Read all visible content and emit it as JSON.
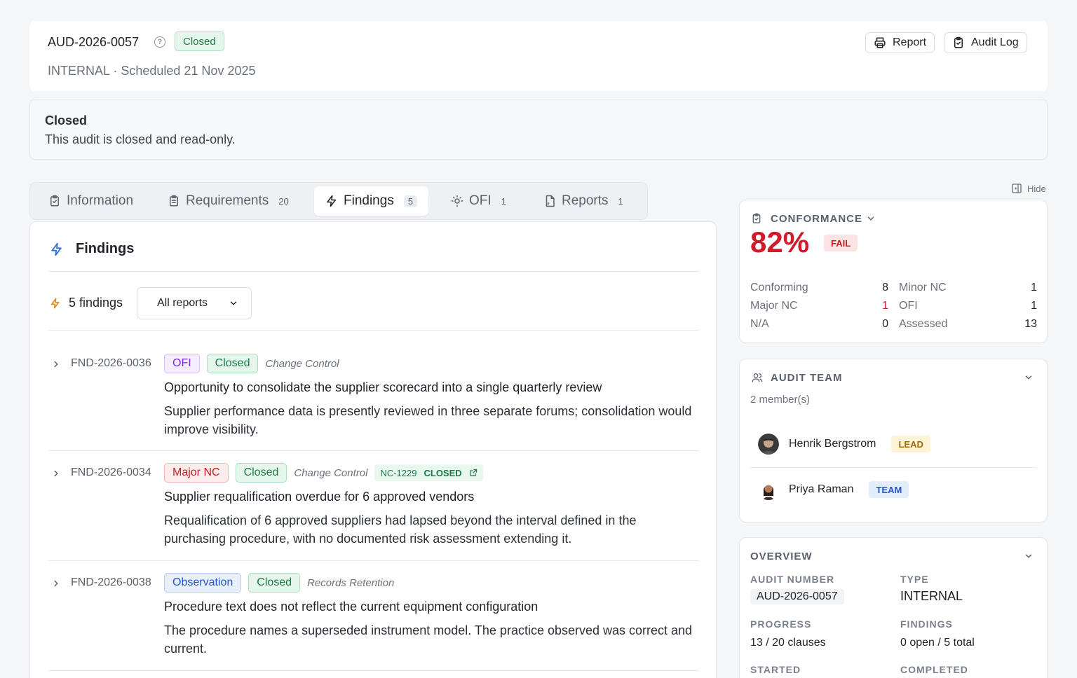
{
  "header": {
    "audit_id": "AUD-2026-0057",
    "status": "Closed",
    "subtitle": "INTERNAL · Scheduled 21 Nov 2025",
    "report_label": "Report",
    "audit_log_label": "Audit Log"
  },
  "banner": {
    "title": "Closed",
    "text": "This audit is closed and read-only."
  },
  "tabs": [
    {
      "label": "Information",
      "count": ""
    },
    {
      "label": "Requirements",
      "count": "20"
    },
    {
      "label": "Findings",
      "count": "5"
    },
    {
      "label": "OFI",
      "count": "1"
    },
    {
      "label": "Reports",
      "count": "1"
    }
  ],
  "findings_panel": {
    "title": "Findings",
    "count_label": "5 findings",
    "filter_value": "All reports",
    "items": [
      {
        "id": "FND-2026-0036",
        "type": "OFI",
        "status": "Closed",
        "category": "Change Control",
        "title": "Opportunity to consolidate the supplier scorecard into a single quarterly review",
        "description": "Supplier performance data is presently reviewed in three separate forums; consolidation would improve visibility."
      },
      {
        "id": "FND-2026-0034",
        "type": "Major NC",
        "status": "Closed",
        "category": "Change Control",
        "nc_ref": "NC-1229",
        "nc_status": "CLOSED",
        "title": "Supplier requalification overdue for 6 approved vendors",
        "description": "Requalification of 6 approved suppliers had lapsed beyond the interval defined in the purchasing procedure, with no documented risk assessment extending it."
      },
      {
        "id": "FND-2026-0038",
        "type": "Observation",
        "status": "Closed",
        "category": "Records Retention",
        "title": "Procedure text does not reflect the current equipment configuration",
        "description": "The procedure names a superseded instrument model. The practice observed was correct and current."
      }
    ]
  },
  "sidebar": {
    "hide_label": "Hide",
    "conformance": {
      "heading": "CONFORMANCE",
      "percent": "82%",
      "result": "FAIL",
      "stats": [
        {
          "label": "Conforming",
          "value": "8"
        },
        {
          "label": "Minor NC",
          "value": "1"
        },
        {
          "label": "Major NC",
          "value": "1"
        },
        {
          "label": "OFI",
          "value": "1"
        },
        {
          "label": "N/A",
          "value": "0"
        },
        {
          "label": "Assessed",
          "value": "13"
        }
      ]
    },
    "team": {
      "heading": "AUDIT TEAM",
      "count_label": "2 member(s)",
      "members": [
        {
          "name": "Henrik Bergstrom",
          "role": "LEAD"
        },
        {
          "name": "Priya Raman",
          "role": "TEAM"
        }
      ]
    },
    "overview": {
      "heading": "OVERVIEW",
      "audit_number_label": "AUDIT NUMBER",
      "audit_number": "AUD-2026-0057",
      "type_label": "TYPE",
      "type": "INTERNAL",
      "progress_label": "PROGRESS",
      "progress": "13 / 20 clauses",
      "findings_label": "FINDINGS",
      "findings": "0 open / 5 total",
      "started_label": "STARTED",
      "completed_label": "COMPLETED"
    }
  },
  "colors": {
    "accent_blue": "#2f6fe0",
    "fail_red": "#d11a2a",
    "closed_green": "#1f7a46"
  }
}
